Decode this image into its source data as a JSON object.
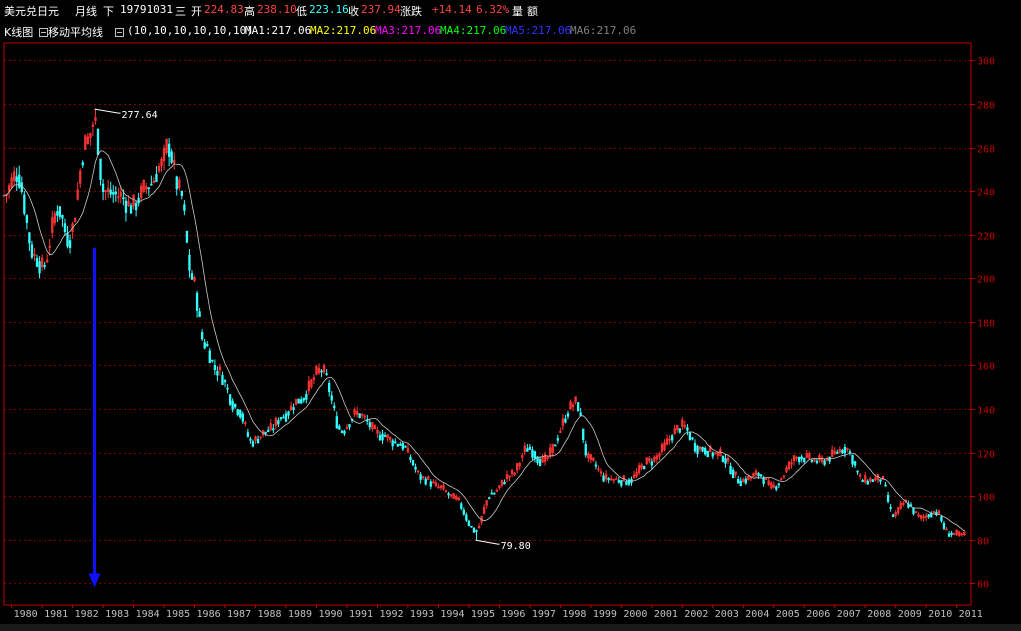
{
  "header": {
    "instrument": "美元兑日元",
    "period": "月线",
    "adjust": "下",
    "date": "19791031",
    "weekday": "三",
    "open_label": "开",
    "open": "224.83",
    "high_label": "高",
    "high": "238.10",
    "low_label": "低",
    "low": "223.16",
    "close_label": "收",
    "close": "237.94",
    "change_label": "涨跌",
    "change": "+14.14",
    "change_pct": "6.32%",
    "volume_label": "量",
    "amount_label": "额"
  },
  "indicator_bar": {
    "kline_label": "K线图",
    "ma_label": "移动平均线",
    "params": "(10,10,10,10,10,10)",
    "ma_values": [
      {
        "label": "MA1:217.06",
        "color": "#ffffff"
      },
      {
        "label": "MA2:217.06",
        "color": "#ffff00"
      },
      {
        "label": "MA3:217.06",
        "color": "#ff00ff"
      },
      {
        "label": "MA4:217.06",
        "color": "#00ff00"
      },
      {
        "label": "MA5:217.06",
        "color": "#3333ff"
      },
      {
        "label": "MA6:217.06",
        "color": "#808080"
      }
    ]
  },
  "colors": {
    "up": "#ff3333",
    "down": "#33ffff",
    "frame": "#c00000",
    "grid": "#800000",
    "ma": "#c8c8c8",
    "arrow": "#1010ff"
  },
  "chart_data": {
    "type": "candlestick",
    "title": "美元兑日元 月线",
    "y_ticks": [
      60,
      80,
      100,
      120,
      140,
      160,
      180,
      200,
      220,
      240,
      260,
      280,
      300
    ],
    "ylim": [
      50,
      308
    ],
    "x_labels": [
      "1980",
      "1981",
      "1982",
      "1983",
      "1984",
      "1985",
      "1986",
      "1987",
      "1988",
      "1989",
      "1990",
      "1991",
      "1992",
      "1993",
      "1994",
      "1995",
      "1996",
      "1997",
      "1998",
      "1999",
      "2000",
      "2001",
      "2002",
      "2003",
      "2004",
      "2005",
      "2006",
      "2007",
      "2008",
      "2009",
      "2010",
      "2011"
    ],
    "xlim": [
      1979.83,
      2011.55
    ],
    "grid": true,
    "annotations": [
      {
        "label": "277.64",
        "x": 1982.8,
        "y": 277.64
      },
      {
        "label": "79.80",
        "x": 1995.3,
        "y": 79.8
      }
    ],
    "arrow": {
      "x": 1982.8,
      "y_from": 214,
      "y_to": 59,
      "direction": "down"
    },
    "anchors": [
      [
        1979.83,
        238
      ],
      [
        1980.25,
        248
      ],
      [
        1980.83,
        210
      ],
      [
        1981.1,
        205
      ],
      [
        1981.6,
        232
      ],
      [
        1981.95,
        218
      ],
      [
        1982.55,
        263
      ],
      [
        1982.8,
        272
      ],
      [
        1983.1,
        240
      ],
      [
        1983.6,
        238
      ],
      [
        1984.0,
        233
      ],
      [
        1984.6,
        243
      ],
      [
        1985.0,
        252
      ],
      [
        1985.2,
        261
      ],
      [
        1985.6,
        240
      ],
      [
        1986.0,
        200
      ],
      [
        1986.4,
        170
      ],
      [
        1986.8,
        158
      ],
      [
        1987.5,
        140
      ],
      [
        1987.95,
        125
      ],
      [
        1988.5,
        130
      ],
      [
        1989.0,
        137
      ],
      [
        1989.5,
        144
      ],
      [
        1990.25,
        158
      ],
      [
        1990.9,
        130
      ],
      [
        1991.4,
        138
      ],
      [
        1992.2,
        128
      ],
      [
        1992.8,
        124
      ],
      [
        1993.6,
        108
      ],
      [
        1994.1,
        104
      ],
      [
        1994.6,
        99
      ],
      [
        1995.3,
        84
      ],
      [
        1995.8,
        101
      ],
      [
        1996.5,
        110
      ],
      [
        1997.0,
        122
      ],
      [
        1997.5,
        116
      ],
      [
        1998.6,
        143
      ],
      [
        1999.0,
        117
      ],
      [
        1999.6,
        108
      ],
      [
        2000.3,
        107
      ],
      [
        2001.0,
        116
      ],
      [
        2002.1,
        132
      ],
      [
        2002.6,
        122
      ],
      [
        2003.3,
        119
      ],
      [
        2004.0,
        107
      ],
      [
        2004.6,
        110
      ],
      [
        2005.0,
        104
      ],
      [
        2005.9,
        118
      ],
      [
        2006.6,
        116
      ],
      [
        2007.45,
        122
      ],
      [
        2008.0,
        107
      ],
      [
        2008.6,
        108
      ],
      [
        2009.0,
        91
      ],
      [
        2009.4,
        97
      ],
      [
        2009.9,
        90
      ],
      [
        2010.4,
        93
      ],
      [
        2010.8,
        83
      ],
      [
        2011.3,
        82
      ]
    ]
  }
}
